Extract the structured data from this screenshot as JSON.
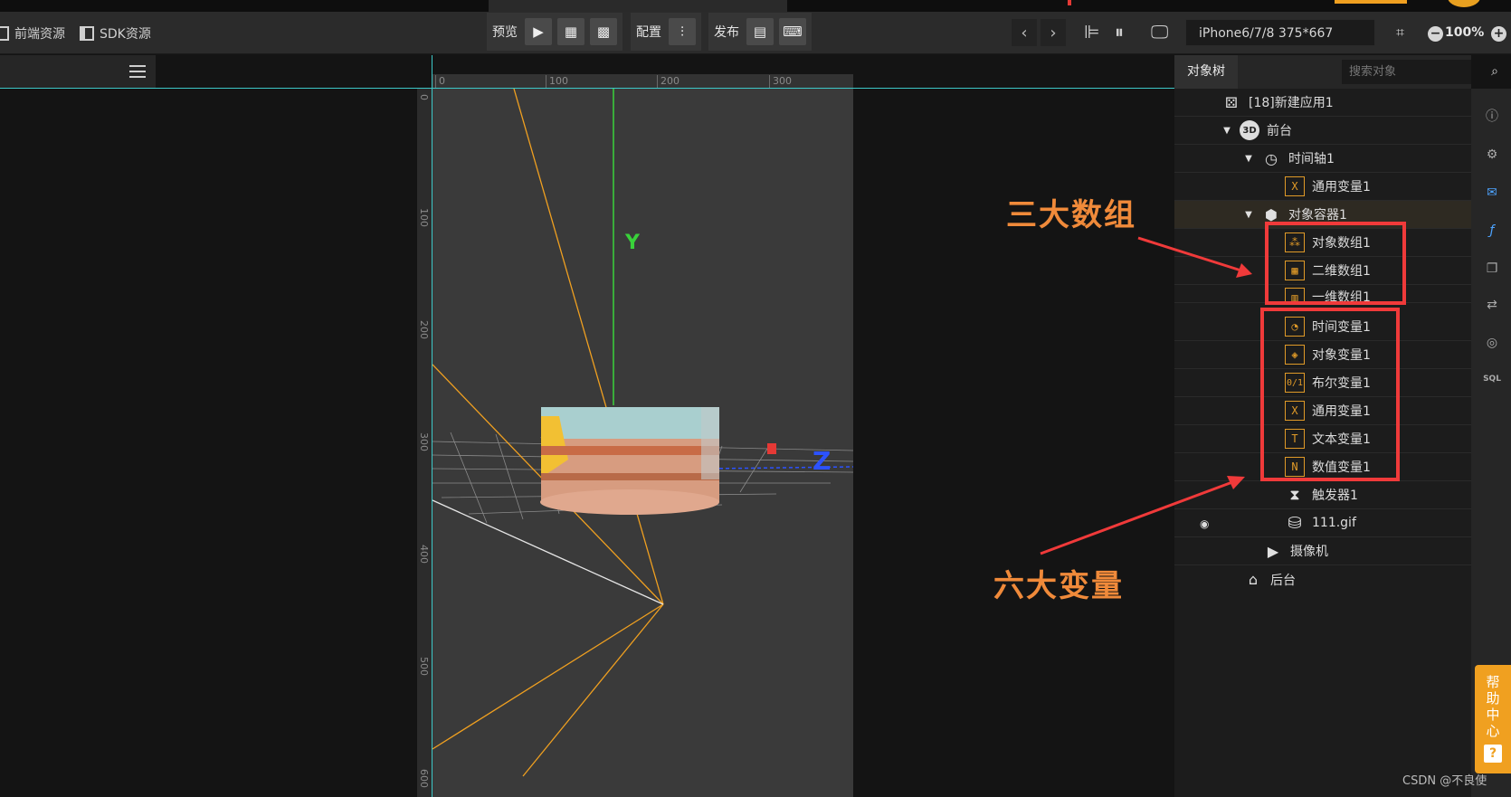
{
  "toolbar": {
    "frontend_resources": "前端资源",
    "sdk_resources": "SDK资源",
    "preview_label": "预览",
    "config_label": "配置",
    "publish_label": "发布",
    "device_value": "iPhone6/7/8 375*667",
    "zoom_level": "100%"
  },
  "ruler": {
    "x_ticks": [
      "0",
      "100",
      "200",
      "300"
    ],
    "y_ticks": [
      "0",
      "100",
      "200",
      "300",
      "400",
      "500",
      "600"
    ]
  },
  "viewport": {
    "axis_y_label": "Y",
    "axis_z_label": "Z"
  },
  "tree": {
    "tab_label": "对象树",
    "search_placeholder": "搜索对象",
    "nodes": [
      {
        "label": "[18]新建应用1",
        "icon": "app-dice-icon"
      },
      {
        "label": "前台",
        "icon": "3d-icon"
      },
      {
        "label": "时间轴1",
        "icon": "clock-icon"
      },
      {
        "label": "通用变量1",
        "icon": "x-var-icon"
      },
      {
        "label": "对象容器1",
        "icon": "box-icon"
      },
      {
        "label": "对象数组1",
        "icon": "object-array-icon"
      },
      {
        "label": "二维数组1",
        "icon": "grid-array-icon"
      },
      {
        "label": "一维数组1",
        "icon": "1d-array-icon"
      },
      {
        "label": "时间变量1",
        "icon": "time-var-icon"
      },
      {
        "label": "对象变量1",
        "icon": "object-var-icon"
      },
      {
        "label": "布尔变量1",
        "icon": "bool-var-icon"
      },
      {
        "label": "通用变量1",
        "icon": "x-var-icon"
      },
      {
        "label": "文本变量1",
        "icon": "text-var-icon"
      },
      {
        "label": "数值变量1",
        "icon": "number-var-icon"
      },
      {
        "label": "触发器1",
        "icon": "hourglass-icon"
      },
      {
        "label": "111.gif",
        "icon": "cylinder-icon"
      },
      {
        "label": "摄像机",
        "icon": "camera-icon"
      },
      {
        "label": "后台",
        "icon": "backend-icon"
      }
    ]
  },
  "annotations": {
    "three_arrays": "三大数组",
    "six_variables": "六大变量"
  },
  "help": {
    "label": "帮助中心",
    "q": "?"
  },
  "watermark": "CSDN @不良使",
  "colors": {
    "accent_orange": "#f0a020",
    "annotation_text": "#f08a3a",
    "annotation_box": "#f03a3a",
    "guide_cyan": "#3cc8c8"
  }
}
